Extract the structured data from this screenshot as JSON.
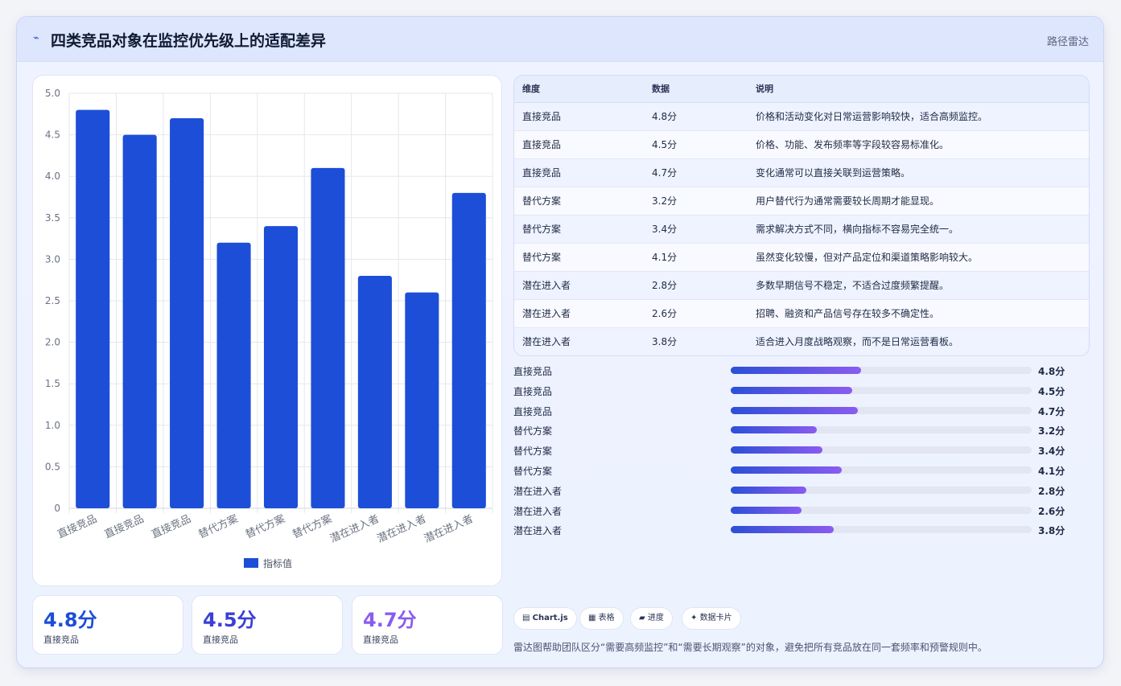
{
  "header": {
    "icon": "lightning-icon",
    "title": "四类竞品对象在监控优先级上的适配差异",
    "tag": "路径雷达"
  },
  "colors": {
    "bar": "#1d4ed8",
    "accent_start": "#2c4fd6",
    "accent_end": "#8a5cf0",
    "stat_colors": [
      "#1d4ed8",
      "#3b3fd6",
      "#8a5cf0"
    ]
  },
  "chart_data": {
    "type": "bar",
    "categories": [
      "直接竞品",
      "直接竞品",
      "直接竞品",
      "替代方案",
      "替代方案",
      "替代方案",
      "潜在进入者",
      "潜在进入者",
      "潜在进入者"
    ],
    "series": [
      {
        "name": "指标值",
        "values": [
          4.8,
          4.5,
          4.7,
          3.2,
          3.4,
          4.1,
          2.8,
          2.6,
          3.8
        ]
      }
    ],
    "ylim": [
      0,
      5.0
    ],
    "yticks": [
      "0",
      "0.5",
      "1.0",
      "1.5",
      "2.0",
      "2.5",
      "3.0",
      "3.5",
      "4.0",
      "4.5",
      "5.0"
    ],
    "grid": true,
    "legend": "bottom",
    "title": "",
    "xlabel": "",
    "ylabel": ""
  },
  "stats": [
    {
      "value": "4.8分",
      "label": "直接竞品"
    },
    {
      "value": "4.5分",
      "label": "直接竞品"
    },
    {
      "value": "4.7分",
      "label": "直接竞品"
    }
  ],
  "table": {
    "headers": [
      "维度",
      "数据",
      "说明"
    ],
    "rows": [
      [
        "直接竞品",
        "4.8分",
        "价格和活动变化对日常运营影响较快，适合高频监控。"
      ],
      [
        "直接竞品",
        "4.5分",
        "价格、功能、发布频率等字段较容易标准化。"
      ],
      [
        "直接竞品",
        "4.7分",
        "变化通常可以直接关联到运营策略。"
      ],
      [
        "替代方案",
        "3.2分",
        "用户替代行为通常需要较长周期才能显现。"
      ],
      [
        "替代方案",
        "3.4分",
        "需求解决方式不同，横向指标不容易完全统一。"
      ],
      [
        "替代方案",
        "4.1分",
        "虽然变化较慢，但对产品定位和渠道策略影响较大。"
      ],
      [
        "潜在进入者",
        "2.8分",
        "多数早期信号不稳定，不适合过度频繁提醒。"
      ],
      [
        "潜在进入者",
        "2.6分",
        "招聘、融资和产品信号存在较多不确定性。"
      ],
      [
        "潜在进入者",
        "3.8分",
        "适合进入月度战略观察，而不是日常运营看板。"
      ]
    ]
  },
  "progress": [
    {
      "label": "直接竞品",
      "value": "4.8分",
      "fraction": 0.433
    },
    {
      "label": "直接竞品",
      "value": "4.5分",
      "fraction": 0.404
    },
    {
      "label": "直接竞品",
      "value": "4.7分",
      "fraction": 0.422
    },
    {
      "label": "替代方案",
      "value": "3.2分",
      "fraction": 0.286
    },
    {
      "label": "替代方案",
      "value": "3.4分",
      "fraction": 0.305
    },
    {
      "label": "替代方案",
      "value": "4.1分",
      "fraction": 0.369
    },
    {
      "label": "潜在进入者",
      "value": "2.8分",
      "fraction": 0.251
    },
    {
      "label": "潜在进入者",
      "value": "2.6分",
      "fraction": 0.235
    },
    {
      "label": "潜在进入者",
      "value": "3.8分",
      "fraction": 0.342
    }
  ],
  "chips": [
    {
      "icon": "chart-icon",
      "label": "Chart.js"
    },
    {
      "icon": "table-icon",
      "label": "表格"
    },
    {
      "icon": "progress-icon",
      "label": "进度"
    },
    {
      "icon": "sparkle-icon",
      "label": "数据卡片"
    }
  ],
  "footnote": "雷达图帮助团队区分“需要高频监控”和“需要长期观察”的对象，避免把所有竞品放在同一套频率和预警规则中。"
}
